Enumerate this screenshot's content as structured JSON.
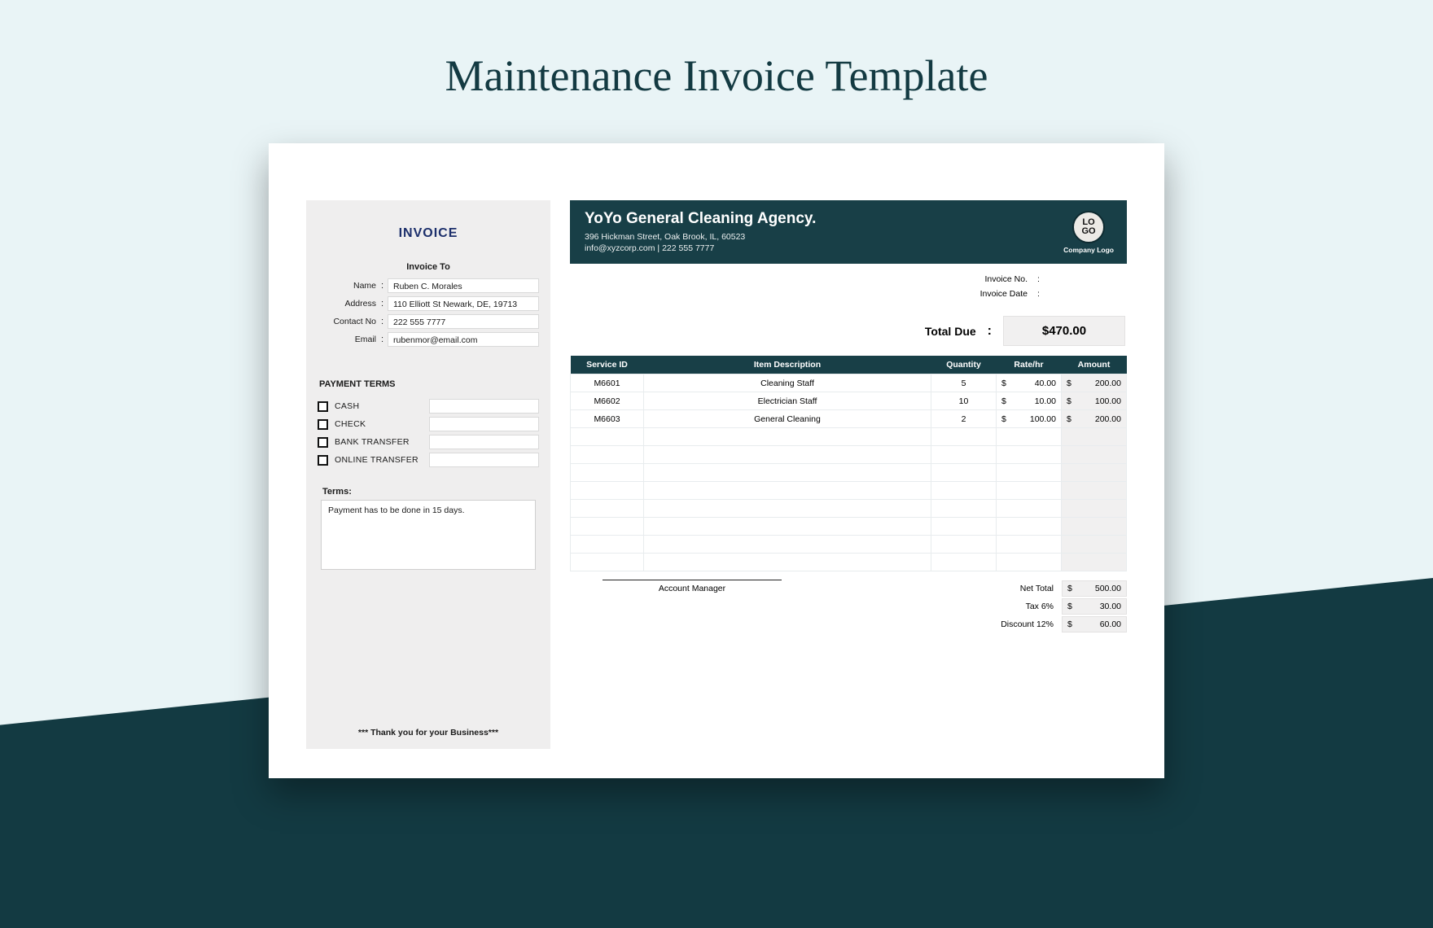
{
  "page": {
    "title": "Maintenance Invoice Template"
  },
  "left": {
    "title": "INVOICE",
    "invoice_to": "Invoice To",
    "fields": {
      "name_label": "Name",
      "name_value": "Ruben C. Morales",
      "address_label": "Address",
      "address_value": "110 Elliott St Newark, DE, 19713",
      "contact_label": "Contact No",
      "contact_value": "222 555 7777",
      "email_label": "Email",
      "email_value": "rubenmor@email.com"
    },
    "payment_terms_title": "PAYMENT TERMS",
    "payment_methods": [
      "CASH",
      "CHECK",
      "BANK TRANSFER",
      "ONLINE TRANSFER"
    ],
    "terms_label": "Terms:",
    "terms_text": "Payment has to be done in 15 days.",
    "thanks": "*** Thank you for your Business***"
  },
  "company": {
    "name": "YoYo General Cleaning Agency.",
    "address": "396 Hickman Street, Oak Brook, IL, 60523",
    "contact": "info@xyzcorp.com | 222 555 7777",
    "logo_text": "LO\nGO",
    "logo_caption": "Company Logo"
  },
  "meta": {
    "invoice_no_label": "Invoice No.",
    "invoice_no_value": "",
    "invoice_date_label": "Invoice Date",
    "invoice_date_value": ""
  },
  "total_due": {
    "label": "Total Due",
    "value": "$470.00"
  },
  "table": {
    "headers": [
      "Service  ID",
      "Item Description",
      "Quantity",
      "Rate/hr",
      "Amount"
    ],
    "rows": [
      {
        "id": "M6601",
        "desc": "Cleaning Staff",
        "qty": "5",
        "rate": "40.00",
        "amount": "200.00"
      },
      {
        "id": "M6602",
        "desc": "Electrician Staff",
        "qty": "10",
        "rate": "10.00",
        "amount": "100.00"
      },
      {
        "id": "M6603",
        "desc": "General Cleaning",
        "qty": "2",
        "rate": "100.00",
        "amount": "200.00"
      }
    ],
    "empty_rows": 8,
    "currency": "$"
  },
  "footer": {
    "sign_label": "Account Manager",
    "totals": [
      {
        "label": "Net Total",
        "value": "500.00"
      },
      {
        "label": "Tax   6%",
        "value": "30.00"
      },
      {
        "label": "Discount  12%",
        "value": "60.00"
      }
    ]
  }
}
